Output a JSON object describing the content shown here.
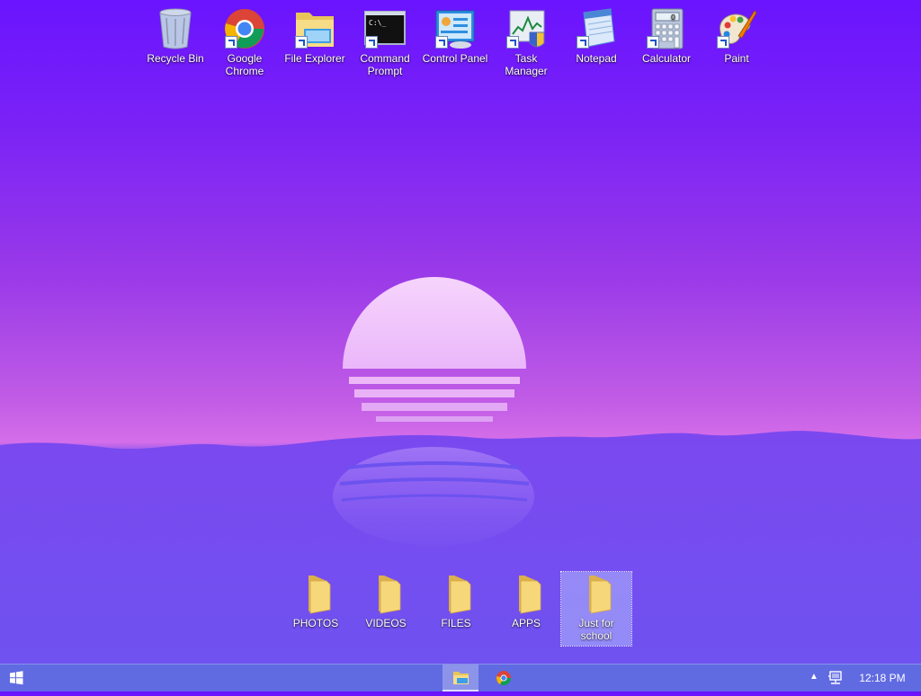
{
  "desktop": {
    "shortcuts": [
      {
        "label": "Recycle Bin",
        "icon": "recycle-bin-icon"
      },
      {
        "label": "Google Chrome",
        "icon": "chrome-icon"
      },
      {
        "label": "File Explorer",
        "icon": "file-explorer-icon"
      },
      {
        "label": "Command Prompt",
        "icon": "command-prompt-icon"
      },
      {
        "label": "Control Panel",
        "icon": "control-panel-icon"
      },
      {
        "label": "Task Manager",
        "icon": "task-manager-icon"
      },
      {
        "label": "Notepad",
        "icon": "notepad-icon"
      },
      {
        "label": "Calculator",
        "icon": "calculator-icon"
      },
      {
        "label": "Paint",
        "icon": "paint-icon"
      }
    ],
    "folders": [
      {
        "label": "PHOTOS",
        "icon": "folder-icon"
      },
      {
        "label": "VIDEOS",
        "icon": "folder-icon"
      },
      {
        "label": "FILES",
        "icon": "folder-icon"
      },
      {
        "label": "APPS",
        "icon": "folder-icon"
      },
      {
        "label": "Just for school",
        "icon": "folder-icon",
        "selected": true
      }
    ],
    "cmd_prompt_glyph": "C:\\_",
    "calculator_display": "0"
  },
  "taskbar": {
    "start_icon": "windows-logo-icon",
    "pinned": [
      {
        "icon": "file-explorer-icon",
        "active": true
      },
      {
        "icon": "chrome-icon",
        "active": false
      }
    ],
    "tray": {
      "chevron": "▲",
      "network_icon": "network-icon",
      "clock": "12:18 PM"
    }
  },
  "colors": {
    "sky_top": "#6a14ff",
    "horizon": "#d56ee9",
    "sun": "#f4c8fb",
    "water": "#6d52ef",
    "taskbar": "#606ee1"
  }
}
